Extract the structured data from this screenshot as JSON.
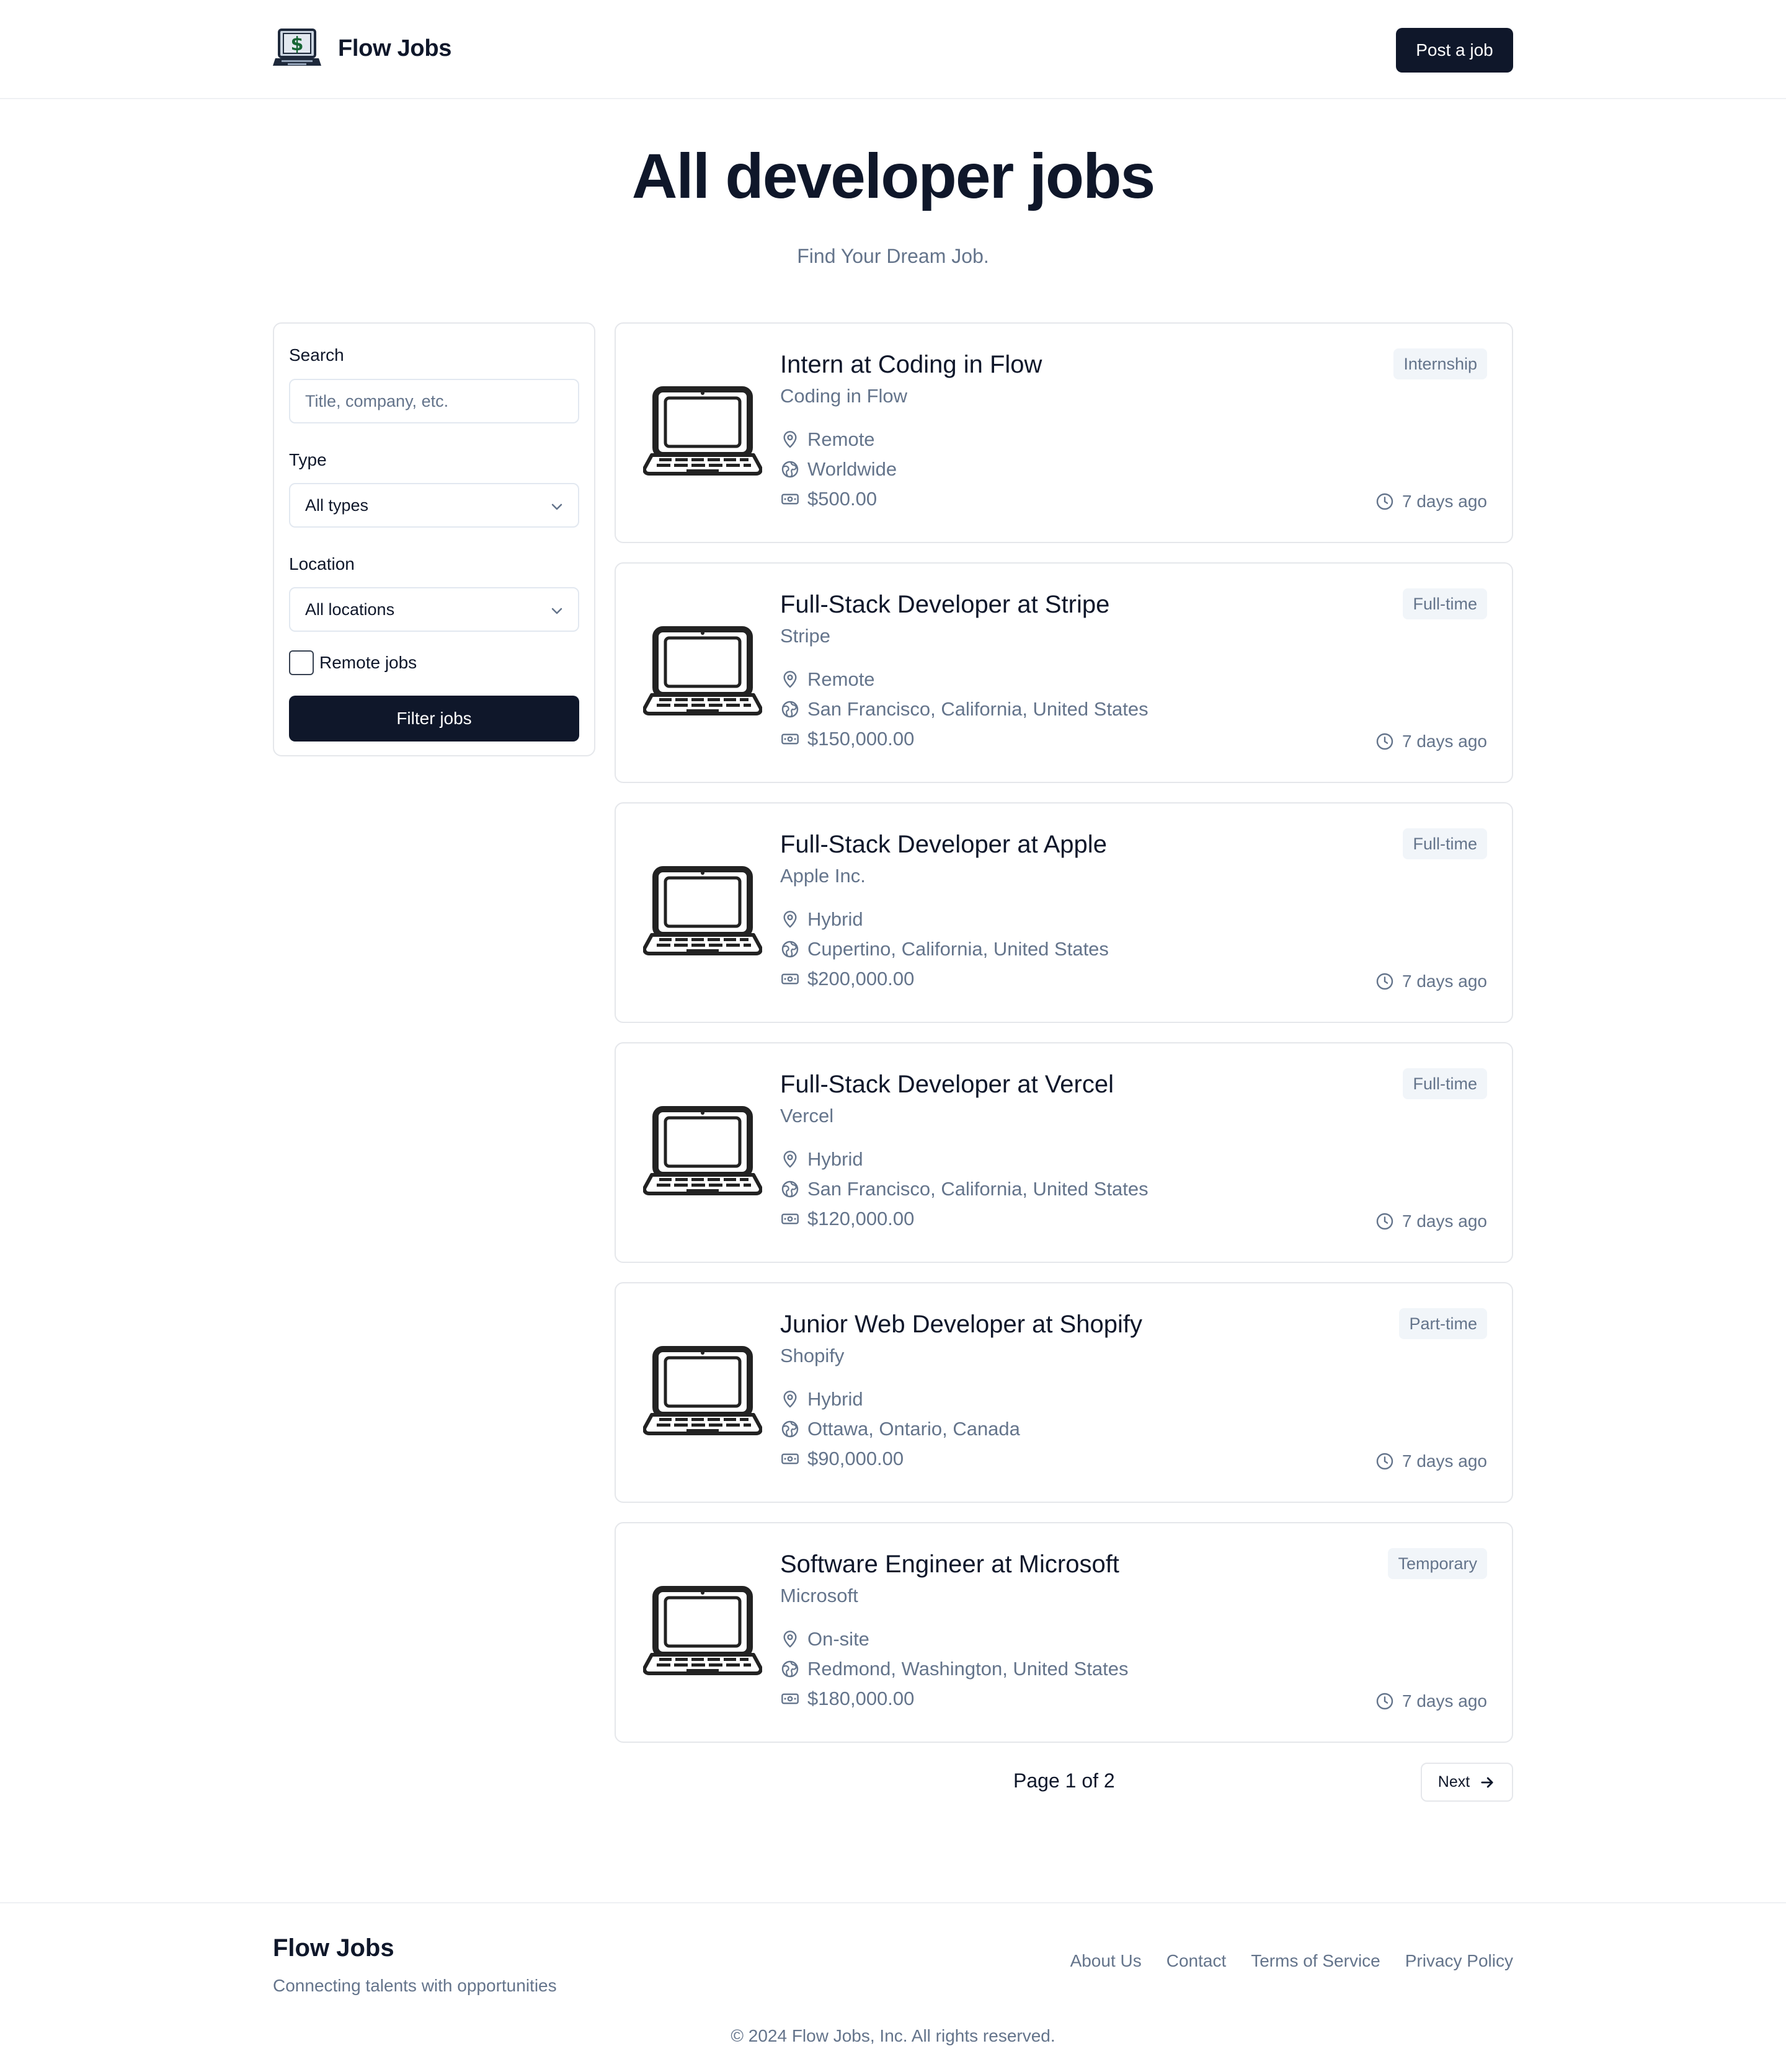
{
  "header": {
    "brand": "Flow Jobs",
    "post_button": "Post a job"
  },
  "hero": {
    "title": "All developer jobs",
    "subtitle": "Find Your Dream Job."
  },
  "filters": {
    "search_label": "Search",
    "search_placeholder": "Title, company, etc.",
    "type_label": "Type",
    "type_value": "All types",
    "location_label": "Location",
    "location_value": "All locations",
    "remote_label": "Remote jobs",
    "remote_checked": false,
    "filter_button": "Filter jobs"
  },
  "jobs": [
    {
      "title": "Intern at Coding in Flow",
      "company": "Coding in Flow",
      "work_mode": "Remote",
      "location": "Worldwide",
      "salary": "$500.00",
      "type": "Internship",
      "posted": "7 days ago"
    },
    {
      "title": "Full-Stack Developer at Stripe",
      "company": "Stripe",
      "work_mode": "Remote",
      "location": "San Francisco, California, United States",
      "salary": "$150,000.00",
      "type": "Full-time",
      "posted": "7 days ago"
    },
    {
      "title": "Full-Stack Developer at Apple",
      "company": "Apple Inc.",
      "work_mode": "Hybrid",
      "location": "Cupertino, California, United States",
      "salary": "$200,000.00",
      "type": "Full-time",
      "posted": "7 days ago"
    },
    {
      "title": "Full-Stack Developer at Vercel",
      "company": "Vercel",
      "work_mode": "Hybrid",
      "location": "San Francisco, California, United States",
      "salary": "$120,000.00",
      "type": "Full-time",
      "posted": "7 days ago"
    },
    {
      "title": "Junior Web Developer at Shopify",
      "company": "Shopify",
      "work_mode": "Hybrid",
      "location": "Ottawa, Ontario, Canada",
      "salary": "$90,000.00",
      "type": "Part-time",
      "posted": "7 days ago"
    },
    {
      "title": "Software Engineer at Microsoft",
      "company": "Microsoft",
      "work_mode": "On-site",
      "location": "Redmond, Washington, United States",
      "salary": "$180,000.00",
      "type": "Temporary",
      "posted": "7 days ago"
    }
  ],
  "pagination": {
    "info": "Page 1 of 2",
    "next_label": "Next"
  },
  "footer": {
    "brand": "Flow Jobs",
    "tagline": "Connecting talents with opportunities",
    "links": [
      "About Us",
      "Contact",
      "Terms of Service",
      "Privacy Policy"
    ],
    "copyright": "© 2024 Flow Jobs, Inc. All rights reserved."
  },
  "icons": {
    "logo": "laptop-dollar-icon",
    "job_logo": "laptop-icon",
    "work_mode": "map-pin-icon",
    "location": "globe-icon",
    "salary": "banknote-icon",
    "posted": "clock-icon",
    "select": "chevron-down-icon",
    "next": "arrow-right-icon"
  },
  "colors": {
    "primary": "#0f172a",
    "muted": "#64748b",
    "border": "#e5e7eb",
    "badge_bg": "#f1f5f9"
  }
}
